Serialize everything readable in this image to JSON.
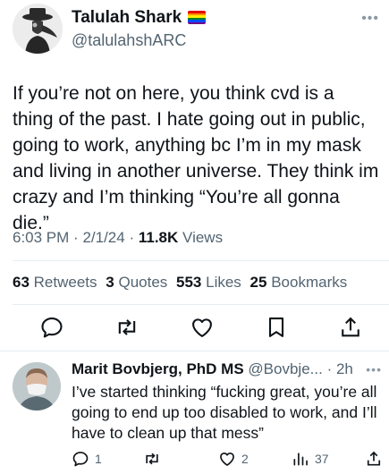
{
  "post": {
    "author": {
      "name": "Talulah Shark",
      "handle": "@talulahshARC",
      "avatar_icon": "plague-doctor-avatar",
      "badge_icon": "rainbow-flag-icon"
    },
    "more_icon": "more-icon",
    "text": "If you’re not on here, you think cvd is a thing of the past. I hate going out in public, going to work, anything bc I’m in my mask and living in another universe. They think im crazy and I’m thinking “You’re all gonna die.”",
    "time": "6:03 PM",
    "date": "2/1/24",
    "views_count": "11.8K",
    "views_label": "Views",
    "separator": "·",
    "stats": [
      {
        "count": "63",
        "label": "Retweets"
      },
      {
        "count": "3",
        "label": "Quotes"
      },
      {
        "count": "553",
        "label": "Likes"
      },
      {
        "count": "25",
        "label": "Bookmarks"
      }
    ],
    "actions": [
      "reply-icon",
      "retweet-icon",
      "like-icon",
      "bookmark-icon",
      "share-icon"
    ]
  },
  "reply": {
    "name": "Marit Bovbjerg, PhD MS",
    "handle": "@Bovbje...",
    "time": "2h",
    "separator": "·",
    "text": "I’ve started thinking “fucking great, you’re all going to end up too disabled to work, and I’ll have to clean up that mess”",
    "actions": [
      {
        "icon": "reply-icon",
        "count": "1"
      },
      {
        "icon": "retweet-icon",
        "count": ""
      },
      {
        "icon": "like-icon",
        "count": "2"
      },
      {
        "icon": "views-icon",
        "count": "37"
      },
      {
        "icon": "share-icon",
        "count": ""
      }
    ]
  },
  "colors": {
    "text": "#0f1419",
    "secondary": "#536471",
    "divider": "#e6ecf0"
  }
}
